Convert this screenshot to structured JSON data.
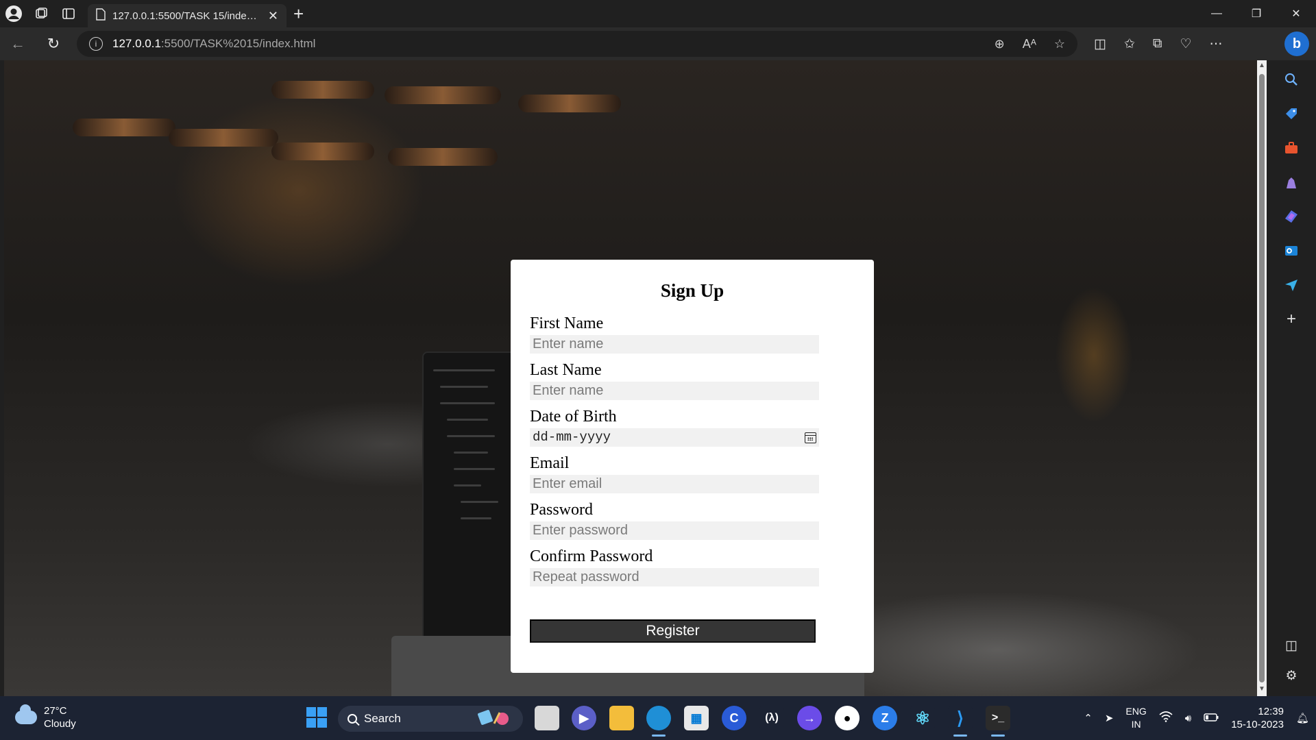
{
  "browser": {
    "tab_title": "127.0.0.1:5500/TASK 15/index.html",
    "address_host": "127.0.0.1",
    "address_path": ":5500/TASK%2015/index.html"
  },
  "form": {
    "title": "Sign Up",
    "fields": [
      {
        "label": "First Name",
        "placeholder": "Enter name"
      },
      {
        "label": "Last Name",
        "placeholder": "Enter name"
      },
      {
        "label": "Date of Birth",
        "placeholder": "dd-mm-yyyy"
      },
      {
        "label": "Email",
        "placeholder": "Enter email"
      },
      {
        "label": "Password",
        "placeholder": "Enter password"
      },
      {
        "label": "Confirm Password",
        "placeholder": "Repeat password"
      }
    ],
    "submit_label": "Register"
  },
  "taskbar": {
    "temperature": "27°C",
    "condition": "Cloudy",
    "search_label": "Search",
    "language": "ENG",
    "region": "IN",
    "time": "12:39",
    "date": "15-10-2023"
  },
  "icons": {
    "browser": [
      "profile-icon",
      "workspaces-icon",
      "tab-actions-icon",
      "page-icon",
      "close-icon",
      "add-icon",
      "minimize-icon",
      "restore-icon",
      "window-close-icon",
      "back-icon",
      "refresh-icon",
      "info-icon",
      "zoom-icon",
      "read-aloud-icon",
      "favorite-icon",
      "split-screen-icon",
      "favorites-icon",
      "collections-icon",
      "performance-icon",
      "more-icon",
      "bing-icon"
    ],
    "sidebar": [
      "search-icon",
      "shopping-icon",
      "tools-icon",
      "games-icon",
      "copilot-icon",
      "outlook-icon",
      "send-icon",
      "add-icon",
      "sidebar-toggle-icon",
      "settings-icon"
    ]
  },
  "colors": {
    "taskbar": "#1c2333",
    "button": "#353535",
    "input_bg": "#f1f1f1",
    "accent": "#3aa0f5"
  }
}
